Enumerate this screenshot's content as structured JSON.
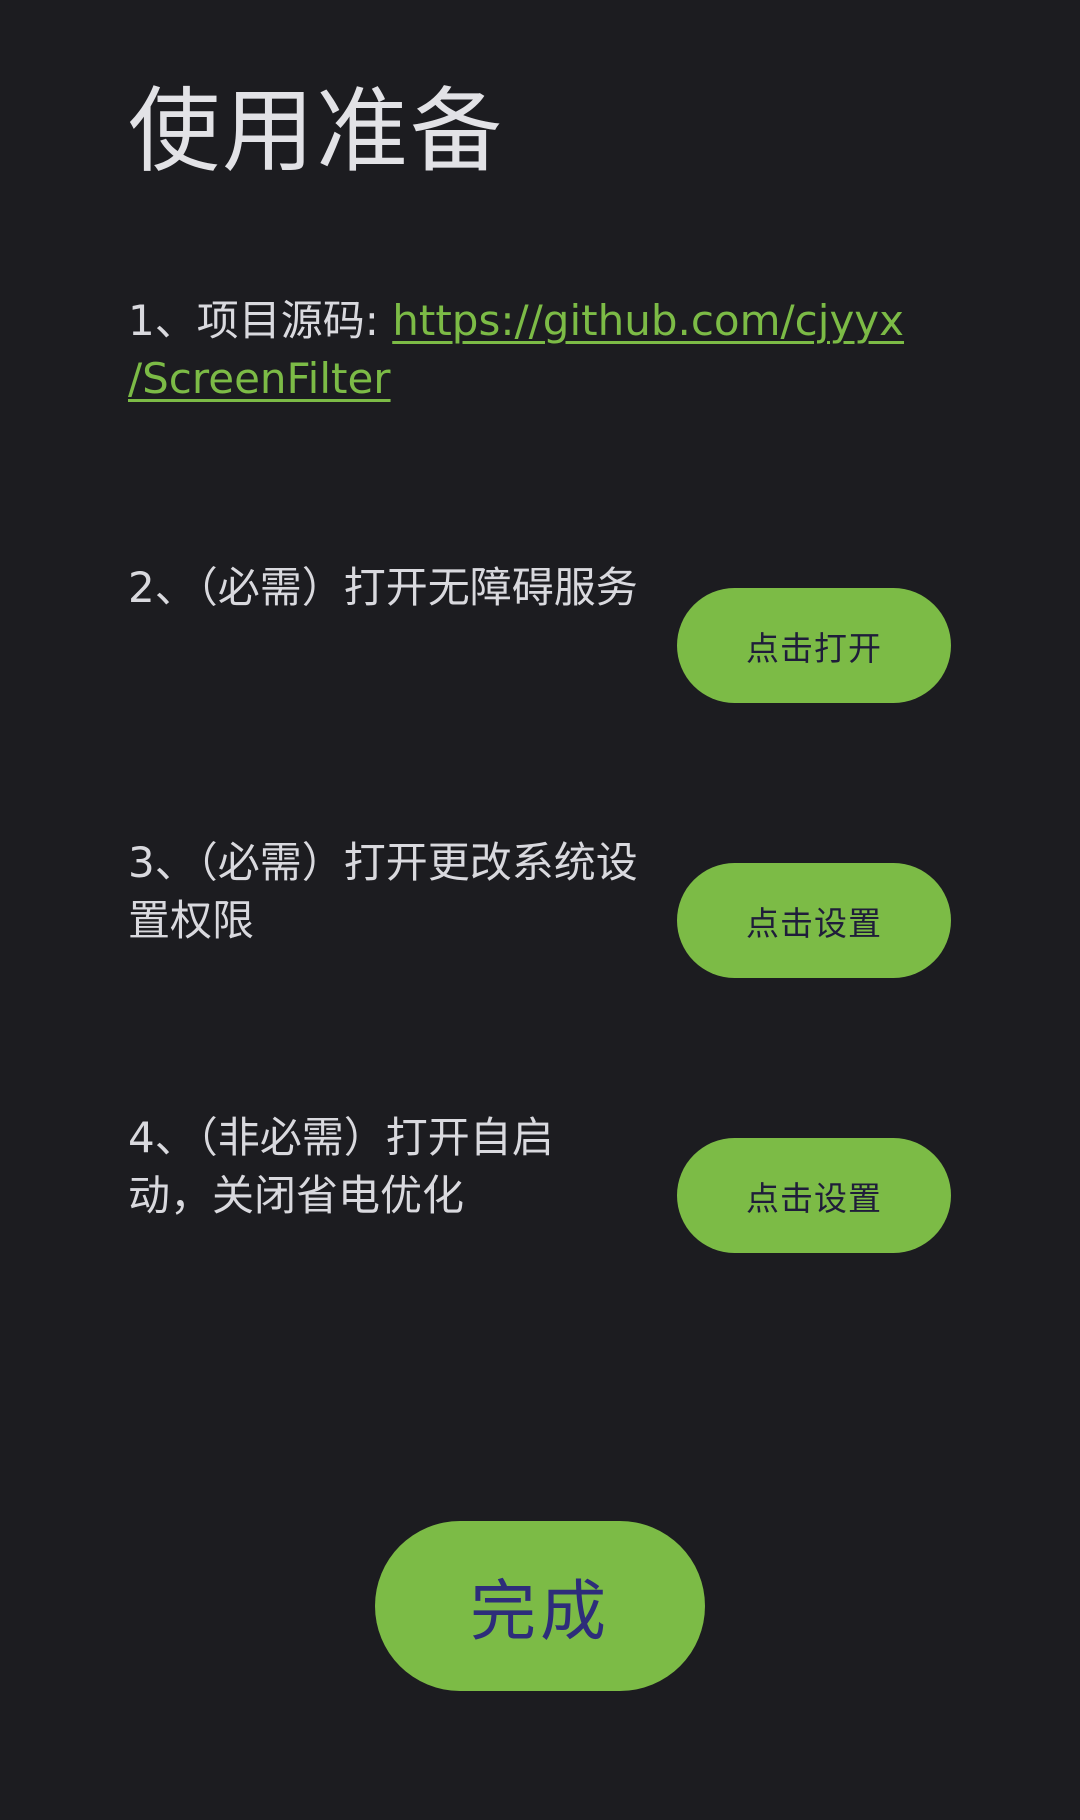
{
  "page": {
    "title": "使用准备"
  },
  "steps": [
    {
      "prefix": "1、项目源码: ",
      "link_line1": "https://github.com/cjyyx",
      "link_line2": "/ScreenFilter"
    },
    {
      "text": "2、（必需）打开无障碍服务",
      "button_label": "点击打开"
    },
    {
      "text": "3、（必需）打开更改系统设置权限",
      "button_label": "点击设置"
    },
    {
      "text": "4、（非必需）打开自启动，关闭省电优化",
      "button_label": "点击设置"
    }
  ],
  "done_button": {
    "label": "完成"
  },
  "colors": {
    "background": "#1c1c20",
    "accent": "#7cbb46",
    "text": "#d9d9de",
    "button_text": "#1f1d3a"
  }
}
